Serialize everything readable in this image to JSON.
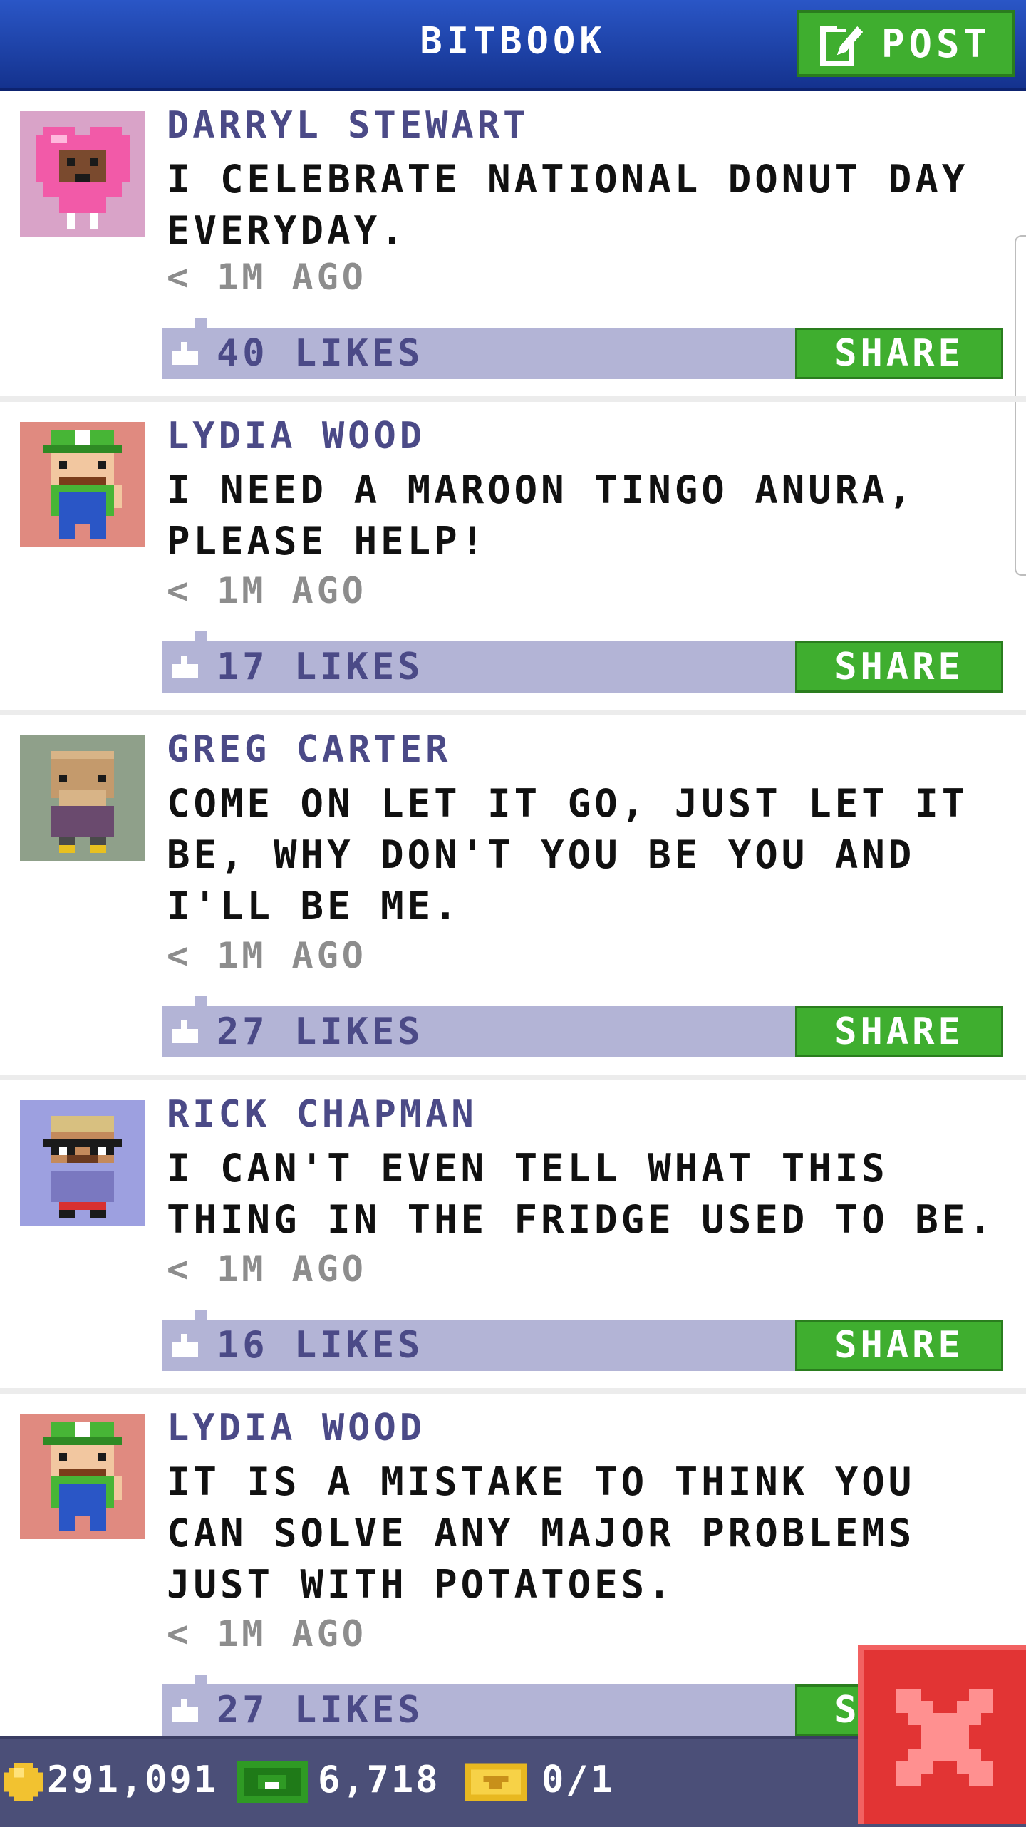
{
  "app": {
    "title": "BITBOOK"
  },
  "toolbar": {
    "post_label": "POST"
  },
  "posts": [
    {
      "author": "DARRYL STEWART",
      "message": "I CELEBRATE NATIONAL DONUT DAY EVERYDAY.",
      "time": "< 1M AGO",
      "likes": "40 LIKES",
      "share_label": "SHARE",
      "avatar_icon": "donut-avatar-icon"
    },
    {
      "author": "LYDIA WOOD",
      "message": "I NEED A MAROON TINGO ANURA, PLEASE HELP!",
      "time": "< 1M AGO",
      "likes": "17 LIKES",
      "share_label": "SHARE",
      "avatar_icon": "green-cap-avatar-icon"
    },
    {
      "author": "GREG CARTER",
      "message": "COME ON LET IT GO, JUST LET IT BE, WHY DON'T YOU BE YOU AND I'LL BE ME.",
      "time": "< 1M AGO",
      "likes": "27 LIKES",
      "share_label": "SHARE",
      "avatar_icon": "bald-man-avatar-icon"
    },
    {
      "author": "RICK CHAPMAN",
      "message": "I CAN'T EVEN TELL WHAT THIS THING IN THE FRIDGE USED TO BE.",
      "time": "< 1M AGO",
      "likes": "16 LIKES",
      "share_label": "SHARE",
      "avatar_icon": "glasses-avatar-icon"
    },
    {
      "author": "LYDIA WOOD",
      "message": "IT IS A MISTAKE TO THINK YOU CAN SOLVE ANY MAJOR PROBLEMS JUST WITH POTATOES.",
      "time": "< 1M AGO",
      "likes": "27 LIKES",
      "share_label": "SHARE",
      "avatar_icon": "green-cap-avatar-icon"
    }
  ],
  "footer": {
    "coins": "291,091",
    "bux": "6,718",
    "tickets": "0/1"
  },
  "colors": {
    "header": "#1d44aa",
    "accent_green": "#3fae2f",
    "likes_bar": "#b3b4d6",
    "name": "#4b4a87",
    "close": "#e23434"
  }
}
